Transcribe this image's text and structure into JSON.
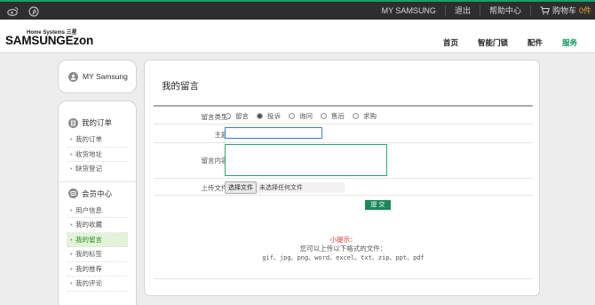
{
  "topbar": {
    "social_icons": [
      "weibo-icon",
      "pinterest-icon"
    ],
    "links": [
      "MY SAMSUNG",
      "退出",
      "帮助中心"
    ],
    "cart_label": "购物车",
    "cart_count": "0件"
  },
  "header": {
    "logo_sub": "Home Systems 三星",
    "logo": "SAMSUNGEzon",
    "nav": [
      "首页",
      "智能门锁",
      "配件",
      "服务"
    ],
    "nav_active": "服务",
    "accent": "#0d9a5a"
  },
  "sidebar": {
    "head": "MY Samsung",
    "sections": [
      {
        "title": "我的订单",
        "items": [
          "我的订单",
          "收货地址",
          "缺货登记"
        ]
      },
      {
        "title": "会员中心",
        "items": [
          "用户信息",
          "我的收藏",
          "我的留言",
          "我的标签",
          "我的推荐",
          "我的评论"
        ]
      }
    ],
    "active_item": "我的留言"
  },
  "form": {
    "title": "我的留言",
    "type_label": "留言类型：",
    "types": [
      "留言",
      "投诉",
      "询问",
      "售后",
      "求购"
    ],
    "type_selected": "投诉",
    "subject_label": "主题：",
    "subject_value": "",
    "content_label": "留言内容：",
    "content_value": "",
    "file_label": "上传文件：",
    "file_button": "选择文件",
    "file_status": "未选择任何文件",
    "submit": "提 交"
  },
  "tips": {
    "heading": "小提示：",
    "line": "您可以上传以下格式的文件：",
    "formats": "gif、jpg、png、word、excel、txt、zip、ppt、pdf"
  }
}
